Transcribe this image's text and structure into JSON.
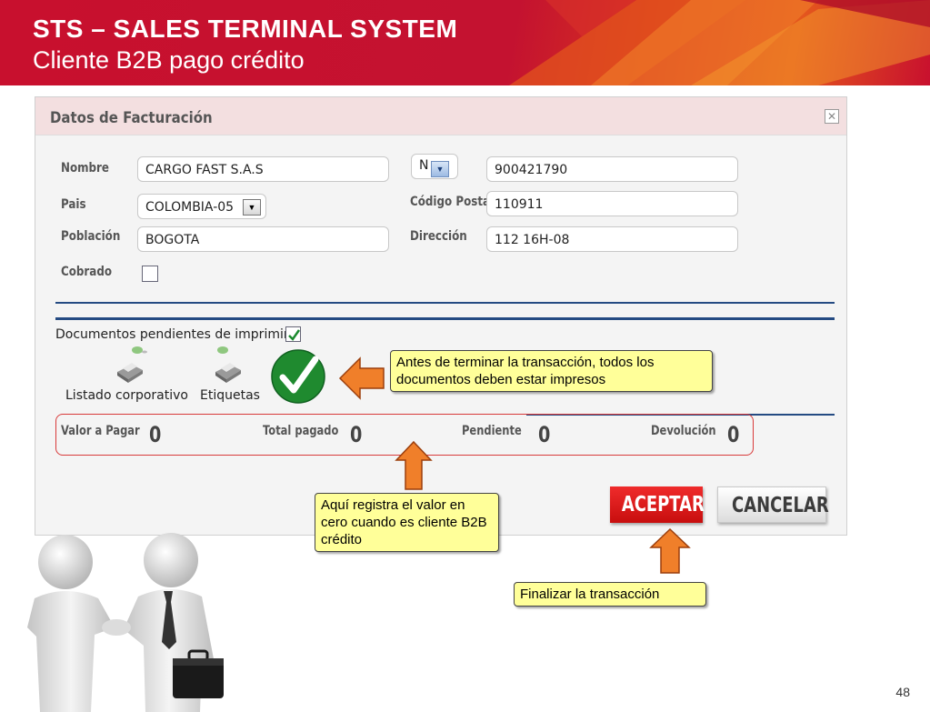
{
  "header": {
    "title": "STS – SALES  TERMINAL SYSTEM",
    "subtitle": "Cliente B2B pago crédito"
  },
  "dialog": {
    "title": "Datos de Facturación",
    "close_icon": "close-icon",
    "fields": {
      "nombre_label": "Nombre",
      "nombre_value": "CARGO FAST S.A.S",
      "doc_type_value": "N",
      "nit_value": "900421790",
      "pais_label": "Pais",
      "pais_value": "COLOMBIA-05",
      "codigo_postal_label": "Código Postal",
      "codigo_postal_value": "110911",
      "poblacion_label": "Población",
      "poblacion_value": "BOGOTA",
      "direccion_label": "Dirección",
      "direccion_value": "112 16H-08",
      "cobrado_label": "Cobrado"
    },
    "documents": {
      "label": "Documentos pendientes de imprimir",
      "checked": true,
      "printers": [
        {
          "label": "Listado corporativo",
          "icon": "printer-icon"
        },
        {
          "label": "Etiquetas",
          "icon": "printer-icon"
        }
      ]
    },
    "totals": {
      "valor_label": "Valor a Pagar",
      "valor": "0",
      "total_label": "Total pagado",
      "total": "0",
      "pendiente_label": "Pendiente",
      "pendiente": "0",
      "devolucion_label": "Devolución",
      "devolucion": "0"
    },
    "buttons": {
      "accept": "ACEPTAR",
      "cancel": "CANCELAR"
    }
  },
  "callouts": {
    "print": "Antes de terminar la transacción, todos los documentos deben estar impresos",
    "value": "Aquí registra el valor en cero cuando es cliente B2B crédito",
    "finish": "Finalizar la transacción"
  },
  "page_number": "48",
  "colors": {
    "banner": "#c8102e",
    "accent_orange": "#f07f2a",
    "callout_bg": "#ffff99",
    "accept_red": "#e11b1b",
    "rule_blue": "#244a82"
  }
}
